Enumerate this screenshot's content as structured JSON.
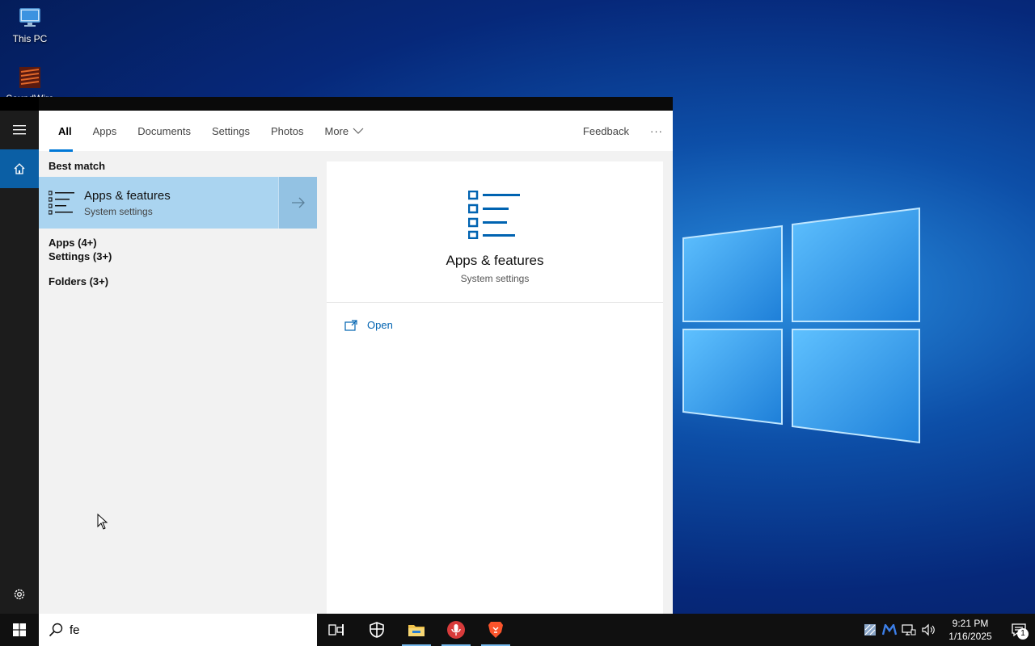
{
  "desktop": {
    "icons": [
      {
        "label": "This PC"
      },
      {
        "label": "SoundWire"
      }
    ]
  },
  "start_menu": {
    "tabs": [
      {
        "label": "All",
        "active": true
      },
      {
        "label": "Apps"
      },
      {
        "label": "Documents"
      },
      {
        "label": "Settings"
      },
      {
        "label": "Photos"
      },
      {
        "label": "More"
      }
    ],
    "feedback_label": "Feedback",
    "more_options_label": "···",
    "best_match_heading": "Best match",
    "best_match": {
      "title": "Apps & features",
      "subtitle": "System settings",
      "icon": "list-settings-icon"
    },
    "groups": [
      {
        "label": "Apps (4+)"
      },
      {
        "label": "Settings (3+)"
      },
      {
        "label": "Folders (3+)"
      }
    ],
    "preview": {
      "title": "Apps & features",
      "subtitle": "System settings",
      "actions": [
        {
          "label": "Open",
          "icon": "open-external-icon"
        }
      ]
    }
  },
  "search": {
    "value": "fe"
  },
  "taskbar": {
    "apps": [
      {
        "name": "task-view",
        "icon": "task-view-icon"
      },
      {
        "name": "windows-security",
        "icon": "shield-icon"
      },
      {
        "name": "file-explorer",
        "icon": "folder-icon",
        "running": true
      },
      {
        "name": "soundwire",
        "icon": "microphone-icon",
        "running": true
      },
      {
        "name": "brave",
        "icon": "brave-lion-icon",
        "running": true
      }
    ],
    "clock": {
      "time": "9:21 PM",
      "date": "1/16/2025"
    },
    "notification_count": "1"
  },
  "colors": {
    "accent": "#0078d7",
    "selection": "#aad4f0",
    "link": "#0063b1"
  }
}
